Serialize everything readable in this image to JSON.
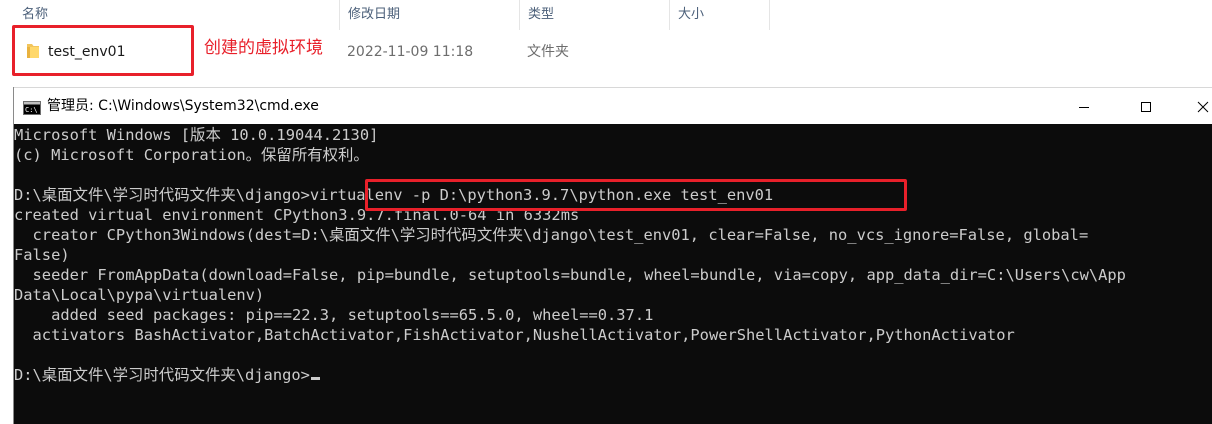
{
  "explorer": {
    "columns": {
      "name": "名称",
      "date": "修改日期",
      "type": "类型",
      "size": "大小"
    },
    "files": [
      {
        "name": "test_env01",
        "modified": "2022-11-09 11:18",
        "type": "文件夹",
        "icon": "folder-icon"
      }
    ],
    "annotation": "创建的虚拟环境"
  },
  "cmd": {
    "title": "管理员: C:\\Windows\\System32\\cmd.exe",
    "lines": [
      "Microsoft Windows [版本 10.0.19044.2130]",
      "(c) Microsoft Corporation。保留所有权利。",
      "",
      "D:\\桌面文件\\学习时代码文件夹\\django>virtualenv -p D:\\python3.9.7\\python.exe test_env01",
      "created virtual environment CPython3.9.7.final.0-64 in 6332ms",
      "  creator CPython3Windows(dest=D:\\桌面文件\\学习时代码文件夹\\django\\test_env01, clear=False, no_vcs_ignore=False, global=",
      "False)",
      "  seeder FromAppData(download=False, pip=bundle, setuptools=bundle, wheel=bundle, via=copy, app_data_dir=C:\\Users\\cw\\App",
      "Data\\Local\\pypa\\virtualenv)",
      "    added seed packages: pip==22.3, setuptools==65.5.0, wheel==0.37.1",
      "  activators BashActivator,BatchActivator,FishActivator,NushellActivator,PowerShellActivator,PythonActivator",
      "",
      "D:\\桌面文件\\学习时代码文件夹\\django>"
    ]
  },
  "colors": {
    "highlight": "#e8202a",
    "console_bg": "#0c0c0c",
    "console_fg": "#cccccc"
  }
}
